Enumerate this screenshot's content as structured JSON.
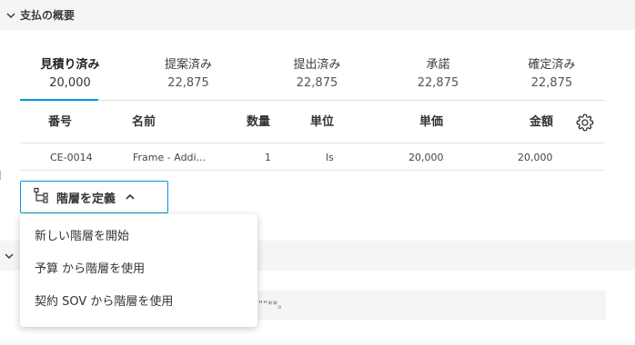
{
  "section": {
    "title": "支払の概要"
  },
  "tabs": [
    {
      "label": "見積り済み",
      "value": "20,000"
    },
    {
      "label": "提案済み",
      "value": "22,875"
    },
    {
      "label": "提出済み",
      "value": "22,875"
    },
    {
      "label": "承諾",
      "value": "22,875"
    },
    {
      "label": "確定済み",
      "value": "22,875"
    }
  ],
  "table": {
    "headers": {
      "number": "番号",
      "name": "名前",
      "qty": "数量",
      "unit": "単位",
      "price": "単価",
      "amount": "金額"
    },
    "rows": [
      {
        "number": "CE-0014",
        "name": "Frame - Addi...",
        "qty": "1",
        "unit": "ls",
        "price": "20,000",
        "amount": "20,000"
      }
    ]
  },
  "hierarchy_button": {
    "label": "階層を定義"
  },
  "dropdown": {
    "items": [
      {
        "label": "新しい階層を開始"
      },
      {
        "label": "予算 から階層を使用"
      },
      {
        "label": "契約 SOV から階層を使用"
      }
    ]
  },
  "background": {
    "text": "\"\"**。"
  },
  "colors": {
    "accent": "#0696d7",
    "header_bg": "#f5f5f5"
  },
  "icons": {
    "collapse": "chevron-down-icon",
    "settings": "gear-icon",
    "hierarchy": "hierarchy-icon",
    "expand": "chevron-up-icon"
  }
}
